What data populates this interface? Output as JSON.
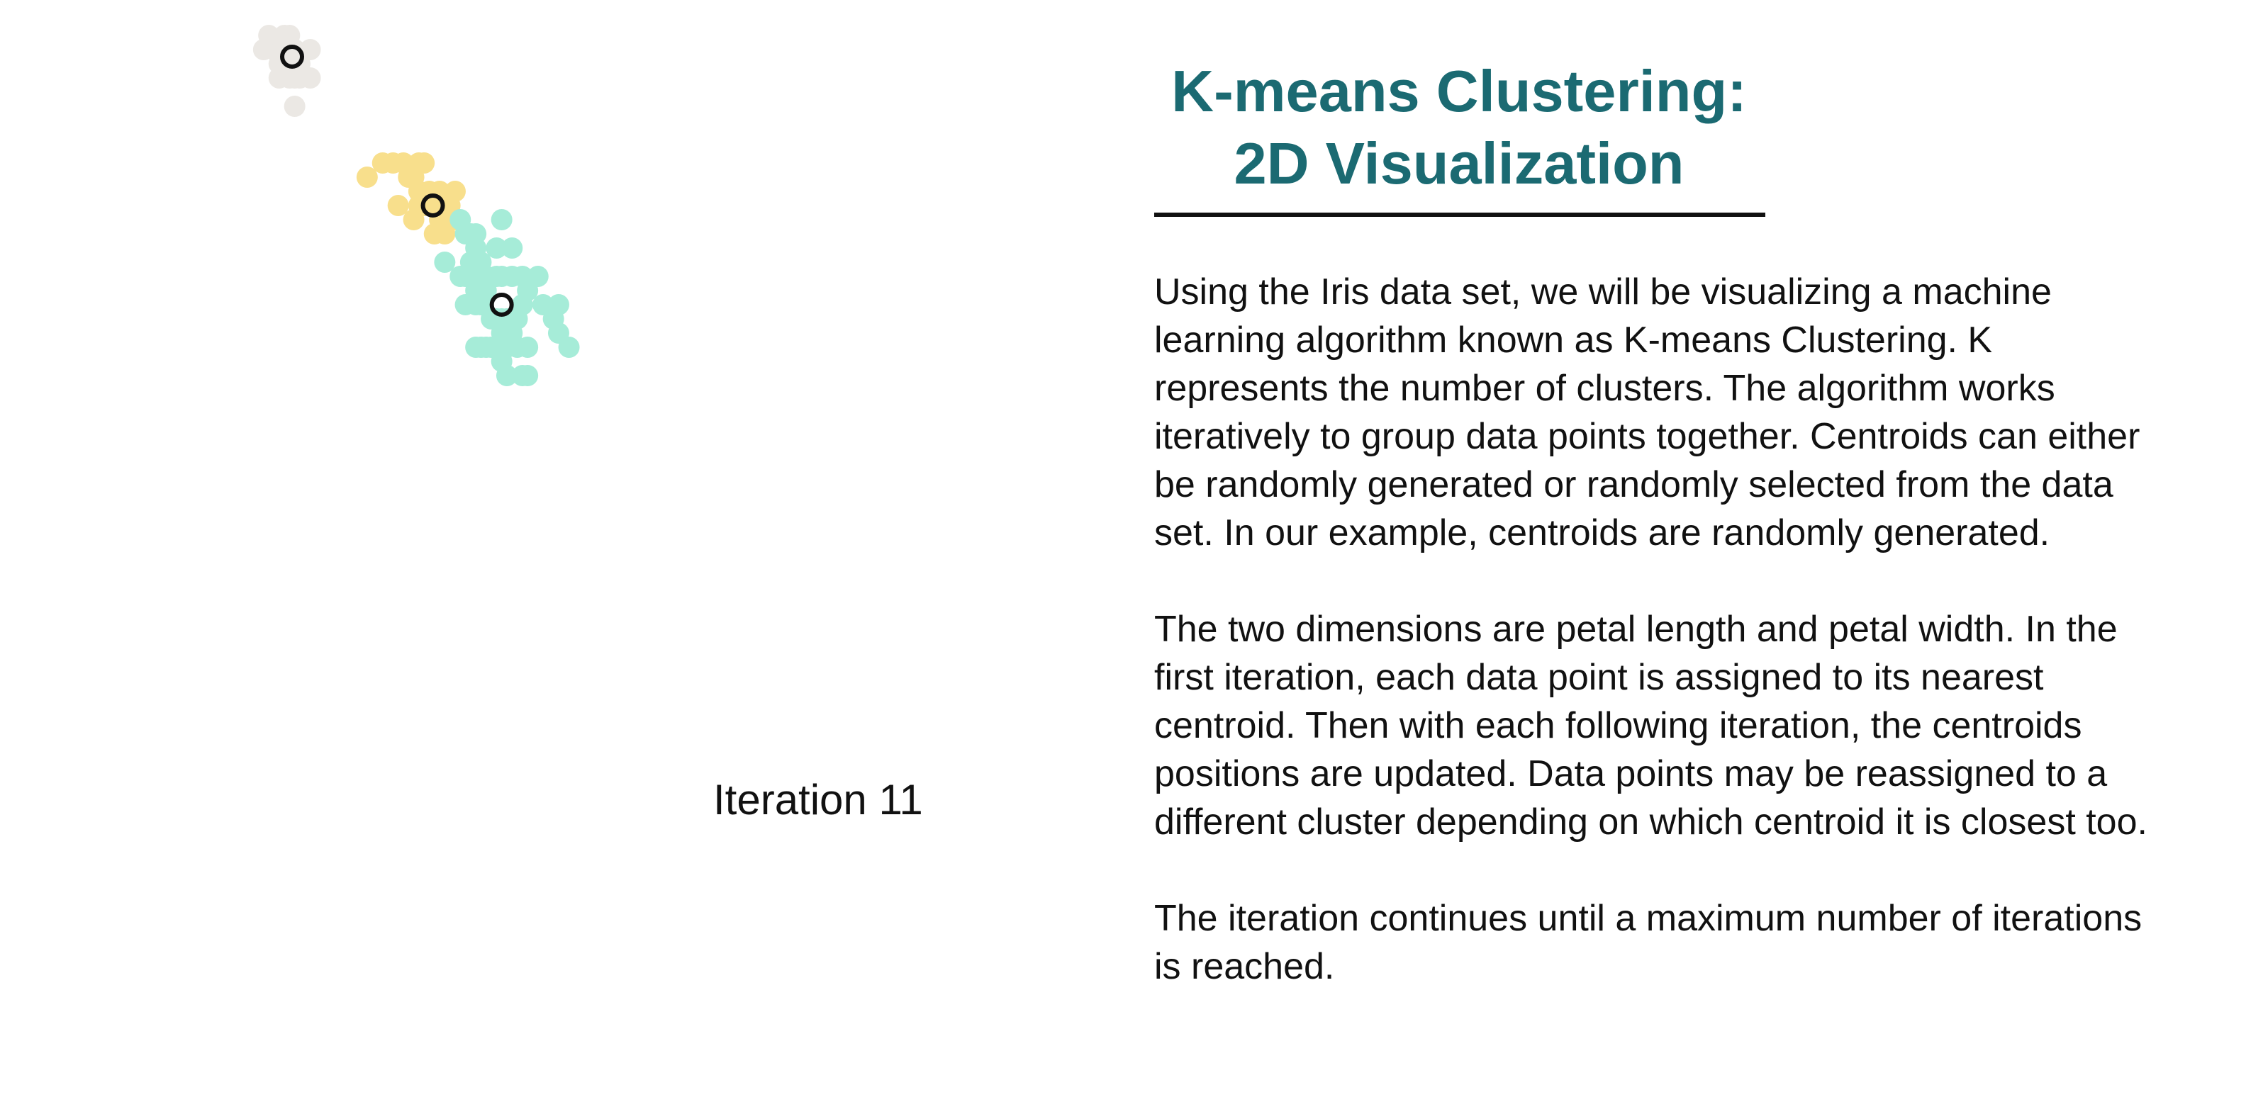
{
  "title_line1": "K-means Clustering:",
  "title_line2": "2D Visualization",
  "paragraphs": [
    "Using the Iris data set, we will be visualizing a machine learning algorithm known as K-means Clustering. K represents the number of clusters. The algorithm works iteratively to group data points together. Centroids can either be randomly generated or randomly selected from the data set. In our example, centroids are randomly generated.",
    "The two dimensions are petal length and petal width. In the first iteration, each data point is assigned to its nearest centroid. Then with each following iteration, the centroids positions are updated. Data points may be reassigned to a different cluster depending on which centroid it is closest too.",
    "The iteration continues until a maximum number of iterations is reached."
  ],
  "iteration_label": "Iteration 11",
  "chart_data": {
    "type": "scatter",
    "title": "",
    "xlabel": "",
    "ylabel": "",
    "grid": false,
    "legend": "none",
    "series": [
      {
        "color": "#ebe8e4",
        "points": [
          [
            1.4,
            0.2
          ],
          [
            1.5,
            0.2
          ],
          [
            1.3,
            0.2
          ],
          [
            1.7,
            0.4
          ],
          [
            1.6,
            0.2
          ],
          [
            1.5,
            0.1
          ],
          [
            1.4,
            0.3
          ],
          [
            1.6,
            0.3
          ],
          [
            1.9,
            0.4
          ],
          [
            1.2,
            0.2
          ],
          [
            1.1,
            0.1
          ],
          [
            1.0,
            0.2
          ],
          [
            1.3,
            0.3
          ],
          [
            1.5,
            0.4
          ],
          [
            1.7,
            0.3
          ],
          [
            1.9,
            0.2
          ],
          [
            1.6,
            0.6
          ],
          [
            1.3,
            0.4
          ],
          [
            1.4,
            0.1
          ],
          [
            1.6,
            0.4
          ]
        ]
      },
      {
        "color": "#f8df8c",
        "points": [
          [
            3.0,
            1.1
          ],
          [
            3.3,
            1.0
          ],
          [
            3.5,
            1.0
          ],
          [
            3.6,
            1.3
          ],
          [
            3.8,
            1.1
          ],
          [
            3.9,
            1.1
          ],
          [
            3.9,
            1.4
          ],
          [
            4.0,
            1.0
          ],
          [
            4.0,
            1.2
          ],
          [
            4.0,
            1.3
          ],
          [
            4.1,
            1.0
          ],
          [
            4.1,
            1.3
          ],
          [
            4.2,
            1.2
          ],
          [
            4.2,
            1.3
          ],
          [
            4.3,
            1.3
          ],
          [
            4.4,
            1.2
          ],
          [
            4.4,
            1.3
          ],
          [
            4.4,
            1.4
          ],
          [
            4.5,
            1.3
          ],
          [
            4.5,
            1.5
          ],
          [
            4.6,
            1.4
          ],
          [
            4.7,
            1.2
          ],
          [
            4.7,
            1.4
          ],
          [
            3.7,
            1.0
          ],
          [
            4.3,
            1.5
          ],
          [
            4.6,
            1.3
          ]
        ]
      },
      {
        "color": "#a6ecd8",
        "points": [
          [
            4.8,
            1.8
          ],
          [
            4.9,
            1.5
          ],
          [
            4.5,
            1.7
          ],
          [
            4.9,
            1.8
          ],
          [
            5.0,
            1.7
          ],
          [
            5.1,
            1.5
          ],
          [
            5.1,
            1.6
          ],
          [
            5.1,
            1.8
          ],
          [
            5.1,
            1.9
          ],
          [
            5.1,
            2.0
          ],
          [
            5.1,
            2.3
          ],
          [
            5.2,
            2.0
          ],
          [
            5.2,
            2.3
          ],
          [
            5.3,
            1.9
          ],
          [
            5.3,
            2.3
          ],
          [
            5.4,
            2.1
          ],
          [
            5.4,
            2.3
          ],
          [
            5.5,
            1.8
          ],
          [
            5.5,
            2.1
          ],
          [
            5.6,
            1.4
          ],
          [
            5.6,
            1.8
          ],
          [
            5.6,
            2.1
          ],
          [
            5.6,
            2.2
          ],
          [
            5.6,
            2.4
          ],
          [
            5.7,
            2.1
          ],
          [
            5.7,
            2.3
          ],
          [
            5.7,
            2.5
          ],
          [
            5.8,
            1.6
          ],
          [
            5.8,
            1.8
          ],
          [
            5.8,
            2.2
          ],
          [
            5.9,
            2.1
          ],
          [
            5.9,
            2.3
          ],
          [
            6.0,
            1.8
          ],
          [
            6.0,
            2.5
          ],
          [
            6.1,
            1.9
          ],
          [
            6.1,
            2.3
          ],
          [
            6.1,
            2.5
          ],
          [
            6.3,
            1.8
          ],
          [
            6.4,
            2.0
          ],
          [
            6.6,
            2.1
          ],
          [
            6.7,
            2.0
          ],
          [
            6.7,
            2.2
          ],
          [
            6.9,
            2.3
          ],
          [
            4.8,
            1.4
          ],
          [
            5.0,
            1.5
          ],
          [
            4.9,
            2.0
          ],
          [
            5.5,
            1.6
          ],
          [
            5.3,
            1.8
          ],
          [
            5.2,
            1.7
          ],
          [
            6.0,
            2.0
          ]
        ]
      }
    ],
    "centroids": [
      [
        1.55,
        0.25
      ],
      [
        4.27,
        1.3
      ],
      [
        5.6,
        2.0
      ]
    ],
    "centroid_color": "#111111"
  }
}
